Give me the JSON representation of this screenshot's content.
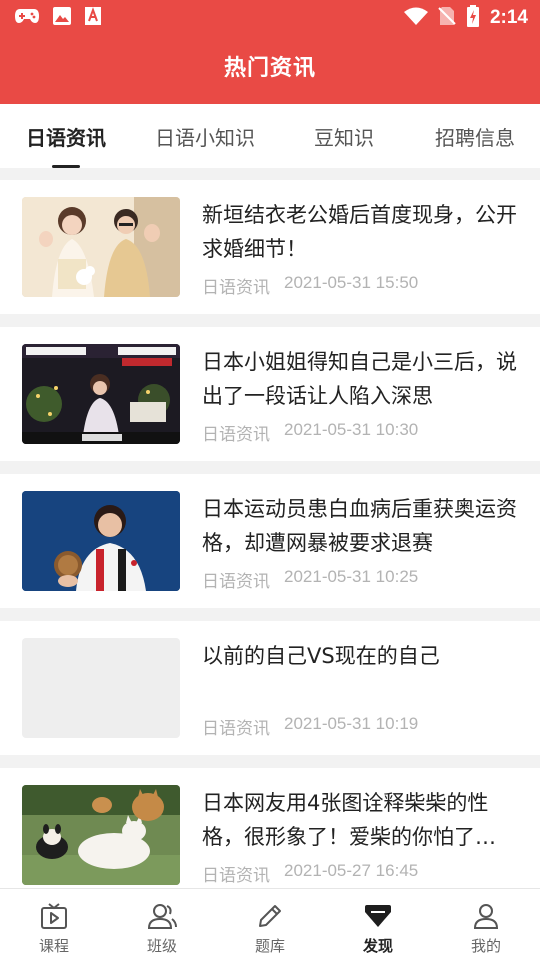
{
  "status_bar": {
    "time": "2:14"
  },
  "header": {
    "title": "热门资讯"
  },
  "tabs": [
    {
      "label": "日语资讯",
      "active": true
    },
    {
      "label": "日语小知识",
      "active": false
    },
    {
      "label": "豆知识",
      "active": false
    },
    {
      "label": "招聘信息",
      "active": false
    }
  ],
  "articles": [
    {
      "title": "新垣结衣老公婚后首度现身，公开求婚细节！",
      "category": "日语资讯",
      "date": "2021-05-31 15:50"
    },
    {
      "title": "日本小姐姐得知自己是小三后，说出了一段话让人陷入深思",
      "category": "日语资讯",
      "date": "2021-05-31 10:30"
    },
    {
      "title": "日本运动员患白血病后重获奥运资格，却遭网暴被要求退赛",
      "category": "日语资讯",
      "date": "2021-05-31 10:25"
    },
    {
      "title": "以前的自己VS现在的自己",
      "category": "日语资讯",
      "date": "2021-05-31 10:19"
    },
    {
      "title": "日本网友用4张图诠释柴柴的性格，很形象了！爱柴的你怕了…",
      "category": "日语资讯",
      "date": "2021-05-27 16:45"
    }
  ],
  "bottom_nav": [
    {
      "label": "课程",
      "icon": "play-screen-icon"
    },
    {
      "label": "班级",
      "icon": "users-icon"
    },
    {
      "label": "题库",
      "icon": "pencil-icon"
    },
    {
      "label": "发现",
      "icon": "diamond-icon",
      "active": true
    },
    {
      "label": "我的",
      "icon": "user-icon"
    }
  ],
  "colors": {
    "brand": "#e94a45",
    "meta": "#b3b3b3",
    "background": "#f2f2f2"
  }
}
